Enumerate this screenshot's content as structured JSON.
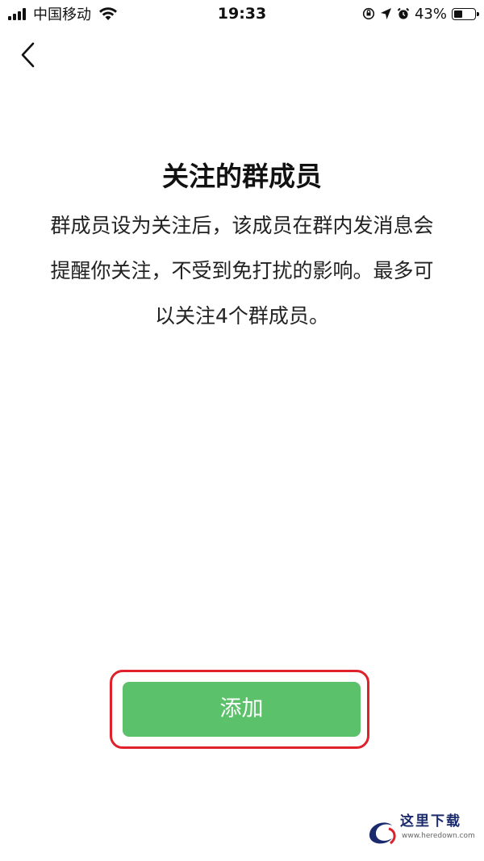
{
  "status_bar": {
    "carrier": "中国移动",
    "time": "19:33",
    "battery_percent": "43%",
    "battery_level": 0.43,
    "icons": [
      "signal-icon",
      "wifi-icon",
      "orientation-lock-icon",
      "location-icon",
      "alarm-icon",
      "battery-icon"
    ]
  },
  "nav": {
    "back_icon": "chevron-left-icon"
  },
  "content": {
    "title": "关注的群成员",
    "description": "群成员设为关注后，该成员在群内发消息会提醒你关注，不受到免打扰的影响。最多可以关注4个群成员。"
  },
  "actions": {
    "add_label": "添加",
    "add_color": "#5bc16a",
    "highlight_color": "#e0202a"
  },
  "watermark": {
    "text": "这里下载",
    "url": "www.heredown.com"
  }
}
